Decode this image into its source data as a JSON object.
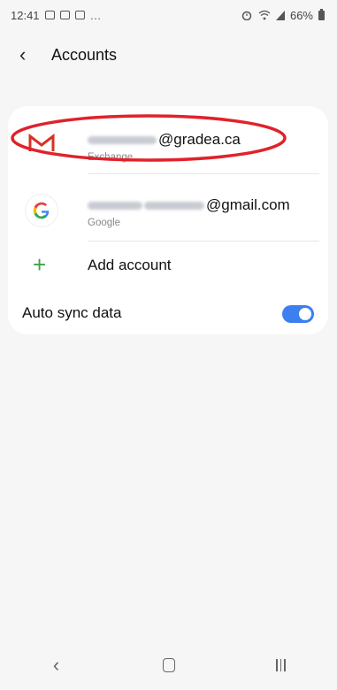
{
  "status_bar": {
    "time": "12:41",
    "overflow": "…",
    "battery": "66%",
    "icons_left": [
      "image-notification-icon",
      "email-notification-icon",
      "gallery-notification-icon"
    ],
    "icons_right": [
      "alarm-icon",
      "wifi-icon",
      "signal-icon",
      "battery-icon"
    ]
  },
  "app_bar": {
    "title": "Accounts",
    "back_icon": "‹"
  },
  "accounts": [
    {
      "email_suffix": "@gradea.ca",
      "type": "Exchange",
      "icon": "exchange-mail-icon"
    },
    {
      "email_suffix": "@gmail.com",
      "type": "Google",
      "icon": "google-icon"
    }
  ],
  "add_account": {
    "label": "Add account",
    "icon": "plus-icon"
  },
  "auto_sync": {
    "label": "Auto sync data",
    "enabled": true
  },
  "highlight": {
    "color": "#e0222a"
  },
  "colors": {
    "accent": "#3b7ff0",
    "add": "#43a047",
    "gmail_red": "#d93025"
  },
  "nav": {
    "back": "‹",
    "home": "home-icon",
    "recents": "recents-icon"
  }
}
